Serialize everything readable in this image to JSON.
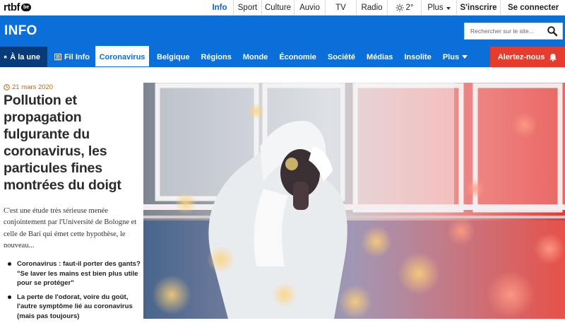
{
  "brand": {
    "logo_text": "rtbf",
    "logo_badge": "be"
  },
  "topnav": {
    "items": [
      "Info",
      "Sport",
      "Culture",
      "Auvio",
      "TV",
      "Radio"
    ],
    "weather": "2°",
    "more": "Plus",
    "signup": "S'inscrire",
    "login": "Se connecter"
  },
  "header": {
    "section": "INFO",
    "search_placeholder": "Rechercher sur le site..."
  },
  "mainnav": {
    "home": "À la une",
    "fil": "Fil Info",
    "items": [
      "Coronavirus",
      "Belgique",
      "Régions",
      "Monde",
      "Économie",
      "Société",
      "Médias",
      "Insolite"
    ],
    "more": "Plus",
    "alert": "Alertez-nous"
  },
  "article": {
    "date": "21 mars 2020",
    "title": "Pollution et propagation fulgurante du coronavirus, les particules fines montrées du doigt",
    "lead": "C'est une étude très sérieuse menée conjointement par l'Université de Bologne et celle de Bari qui émet cette hypothèse, le nouveau...",
    "related": [
      "Coronavirus : faut-il porter des gants? \"Se laver les mains est bien plus utile pour se protéger\"",
      "La perte de l'odorat, voire du goût, l'autre symptôme lié au coronavirus (mais pas toujours)"
    ]
  },
  "colors": {
    "accent_blue": "#0a6fd8",
    "home_dark": "#063a78",
    "alert_red": "#e63c2d",
    "date_orange": "#c16a10"
  },
  "icons": [
    "sun-icon",
    "chevron-down-icon",
    "user-icon",
    "search-icon",
    "home-icon",
    "list-icon",
    "bell-icon",
    "clock-icon"
  ]
}
